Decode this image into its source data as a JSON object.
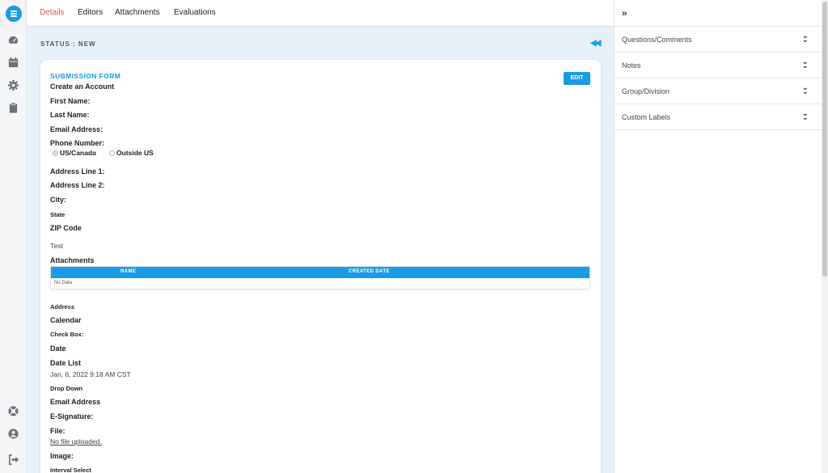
{
  "tabs": [
    {
      "label": "Details",
      "active": true
    },
    {
      "label": "Editors"
    },
    {
      "label": "Attachments"
    },
    {
      "label": "Evaluations"
    }
  ],
  "status": "STATUS : NEW",
  "card": {
    "title": "SUBMISSION FORM",
    "edit_label": "EDIT",
    "form_title": "Create an Account",
    "fields": {
      "first_name": "First Name:",
      "last_name": "Last Name:",
      "email_address": "Email Address:",
      "phone_number": "Phone Number:",
      "phone_options": [
        "US/Canada",
        "Outside US"
      ],
      "address_line1": "Address Line 1:",
      "address_line2": "Address Line 2:",
      "city": "City:",
      "state": "State",
      "zip": "ZIP Code",
      "test": "Test",
      "attachments": "Attachments",
      "attachments_columns": [
        "NAME",
        "CREATED DATE"
      ],
      "attachments_empty": "No Data",
      "address": "Address",
      "calendar": "Calendar",
      "check_box": "Check Box:",
      "date": "Date",
      "date_list": "Date List",
      "date_list_value": "Jan, 6, 2022 9:18 AM CST",
      "drop_down": "Drop Down",
      "email_address2": "Email Address",
      "e_signature": "E-Signature:",
      "file": "File:",
      "file_value": "No file uploaded.",
      "image": "Image:",
      "interval_select": "Interval Select"
    }
  },
  "right_panel": {
    "sections": [
      "Questions/Comments",
      "Notes",
      "Group/Division",
      "Custom Labels"
    ]
  },
  "colors": {
    "accent": "#1b9be6",
    "active_tab": "#e0555a",
    "background": "#e6f1f7"
  }
}
